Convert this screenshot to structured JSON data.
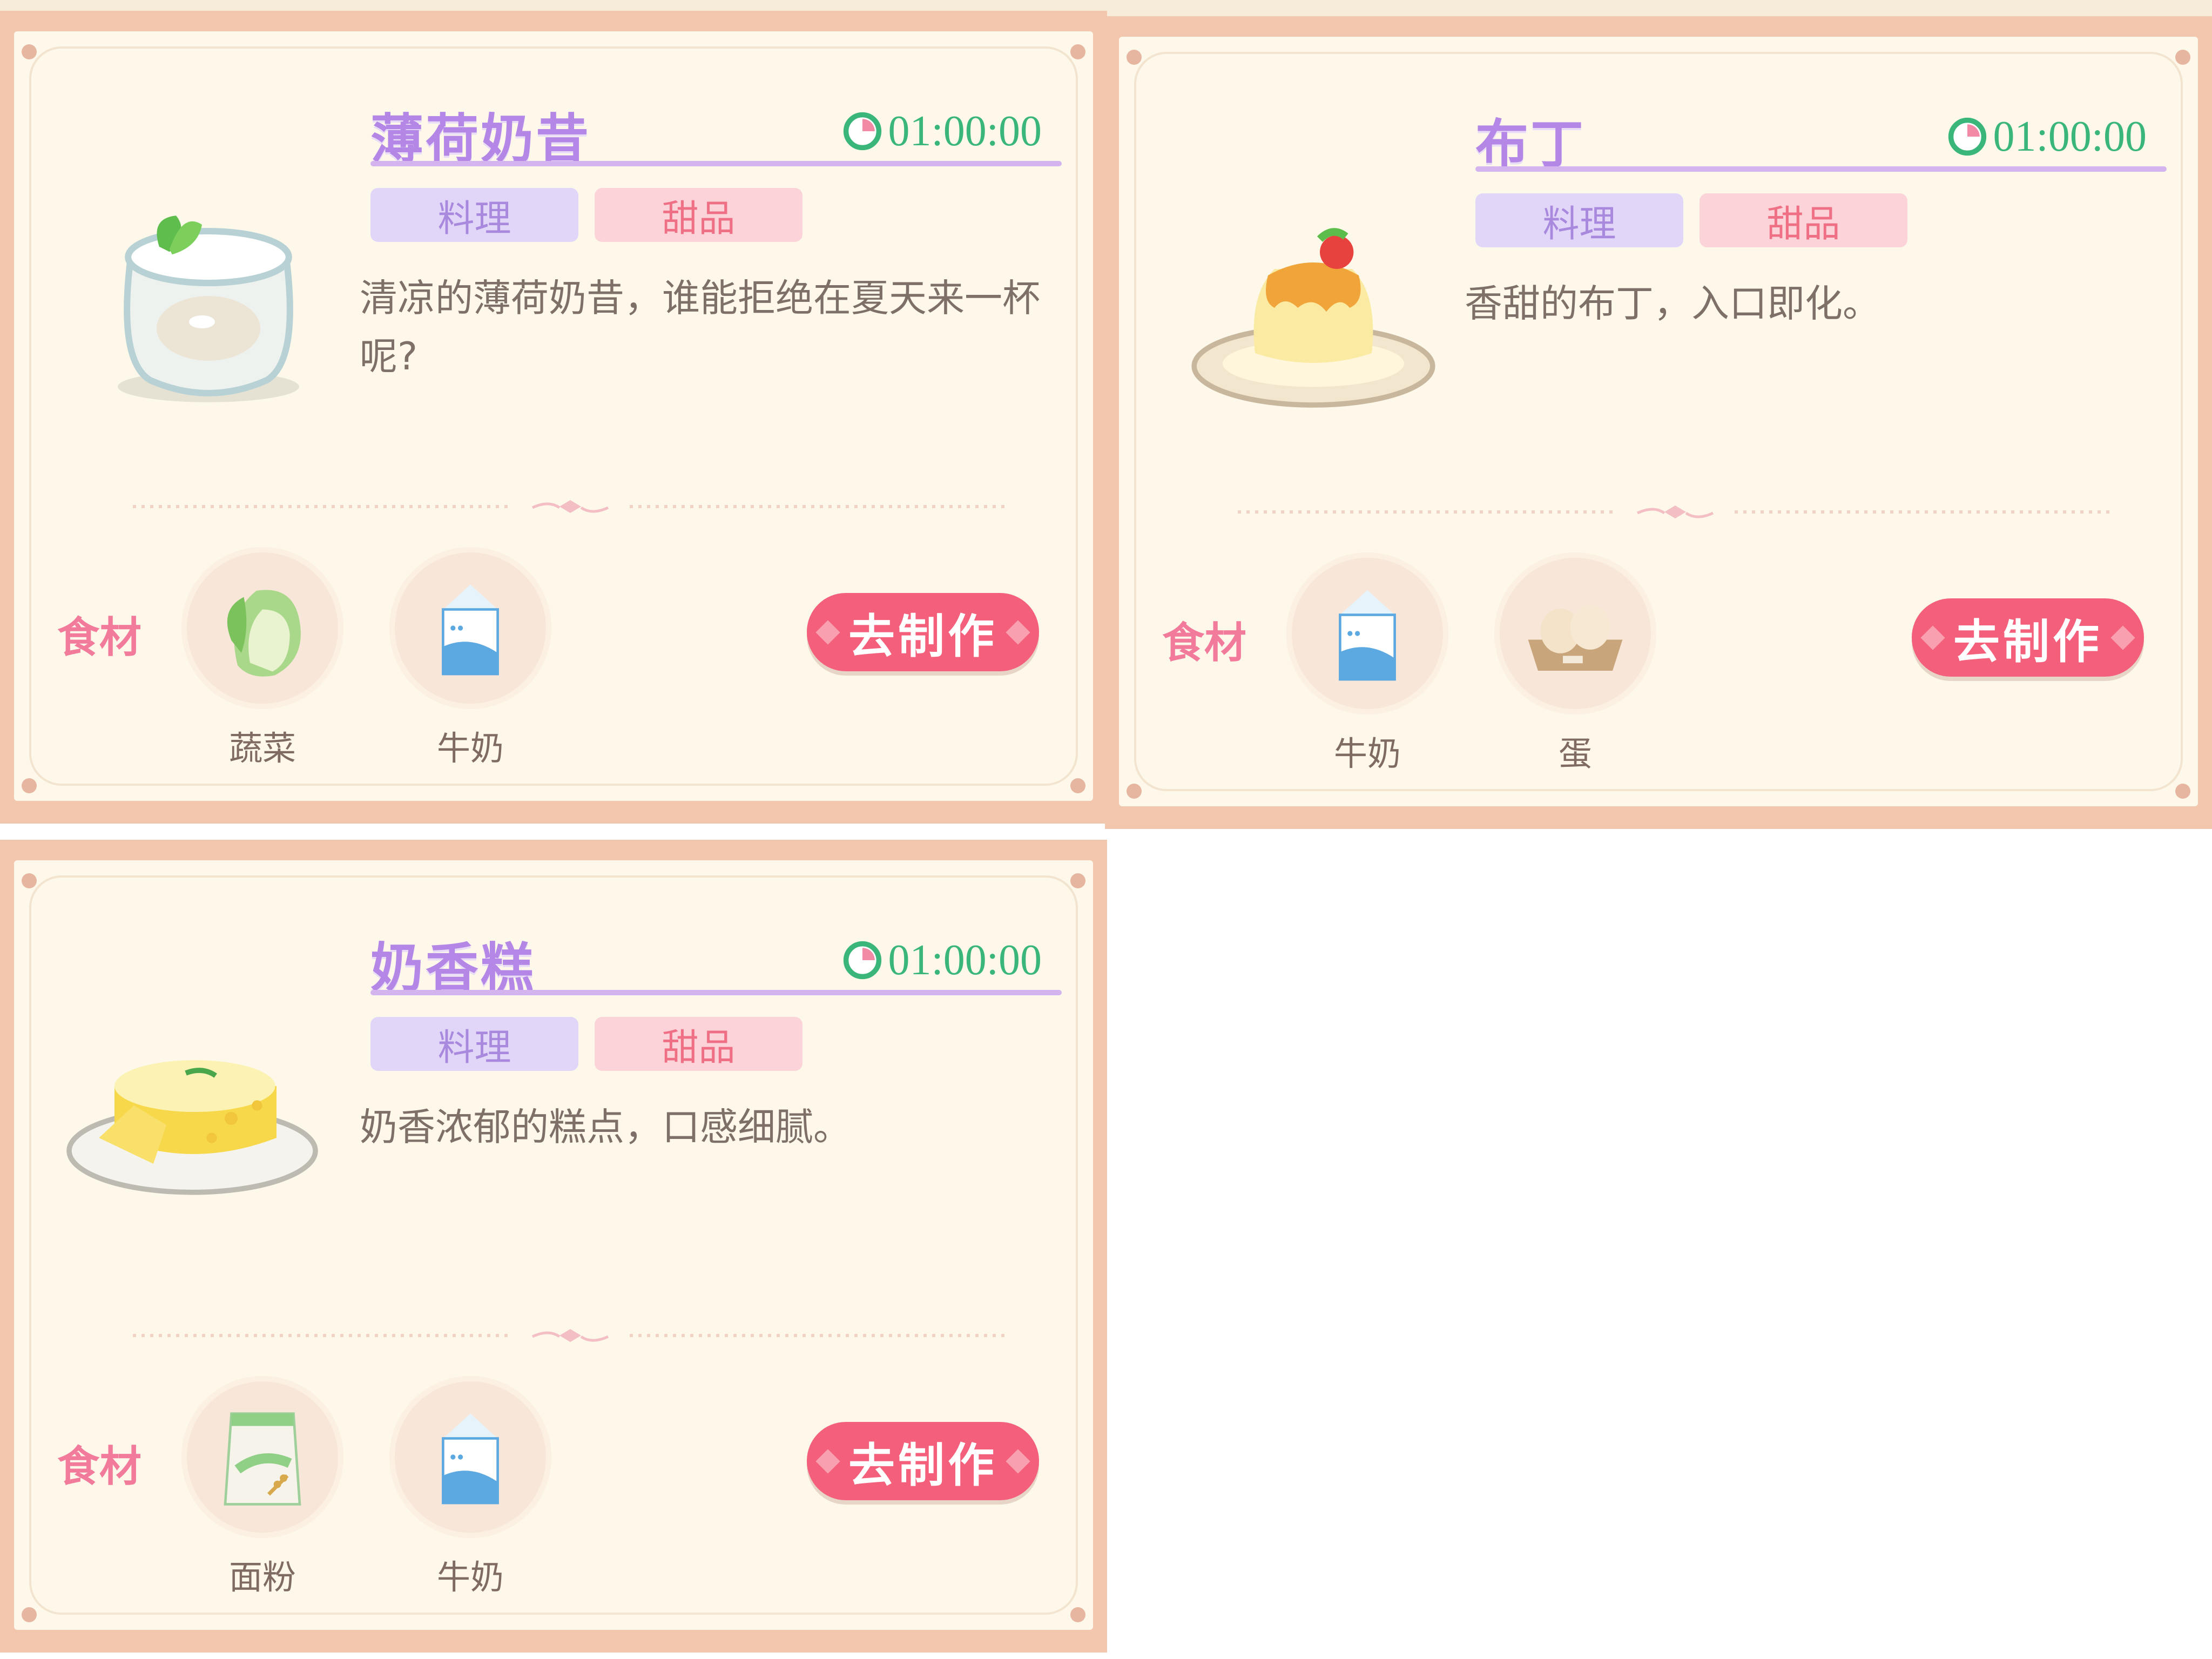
{
  "recipes": [
    {
      "title": "薄荷奶昔",
      "timer": "01:00:00",
      "tags": [
        "料理",
        "甜品"
      ],
      "description": "清凉的薄荷奶昔，谁能拒绝在夏天来一杯呢?",
      "ingredients_label": "食材",
      "ingredients": [
        {
          "name": "蔬菜",
          "icon": "cabbage-icon"
        },
        {
          "name": "牛奶",
          "icon": "milk-carton-icon"
        }
      ],
      "button": "去制作"
    },
    {
      "title": "布丁",
      "timer": "01:00:00",
      "tags": [
        "料理",
        "甜品"
      ],
      "description": "香甜的布丁，入口即化。",
      "ingredients_label": "食材",
      "ingredients": [
        {
          "name": "牛奶",
          "icon": "milk-carton-icon"
        },
        {
          "name": "蛋",
          "icon": "egg-carton-icon"
        }
      ],
      "button": "去制作"
    },
    {
      "title": "奶香糕",
      "timer": "01:00:00",
      "tags": [
        "料理",
        "甜品"
      ],
      "description": "奶香浓郁的糕点，口感细腻。",
      "ingredients_label": "食材",
      "ingredients": [
        {
          "name": "面粉",
          "icon": "flour-bag-icon"
        },
        {
          "name": "牛奶",
          "icon": "milk-carton-icon"
        }
      ],
      "button": "去制作"
    }
  ],
  "colors": {
    "title": "#b487e6",
    "timer": "#3bb67b",
    "button": "#f4607b",
    "tag_cook": "#e1d6f8",
    "tag_sweet": "#fbd3d8"
  }
}
